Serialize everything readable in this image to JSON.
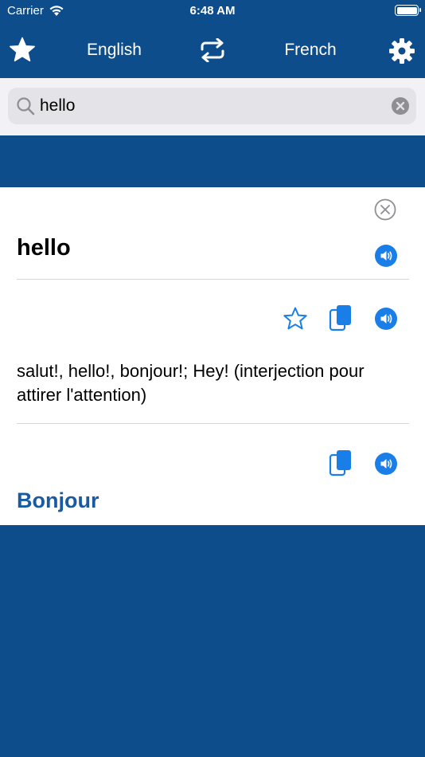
{
  "status": {
    "carrier": "Carrier",
    "time": "6:48 AM"
  },
  "nav": {
    "source_language": "English",
    "target_language": "French"
  },
  "search": {
    "value": "hello",
    "placeholder": ""
  },
  "result": {
    "word": "hello",
    "definition": " salut!, hello!, bonjour!; Hey! (interjection pour attirer l'attention)",
    "translation": "Bonjour"
  },
  "colors": {
    "brand": "#0d4d8b",
    "accent": "#1a7ee8",
    "translation": "#1a5aa0"
  },
  "icons": [
    "favorites-star-icon",
    "swap-languages-icon",
    "settings-gear-icon",
    "search-icon",
    "clear-icon",
    "close-icon",
    "speaker-icon",
    "star-outline-icon",
    "copy-icon"
  ]
}
